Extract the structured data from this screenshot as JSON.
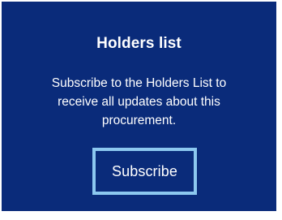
{
  "holders_list": {
    "title": "Holders list",
    "description": "Subscribe to the Holders List to receive all updates about this procurement.",
    "subscribe_button_label": "Subscribe"
  },
  "colors": {
    "card_background": "#0a2b7a",
    "button_border": "#8cc8f0",
    "text": "#ffffff"
  }
}
